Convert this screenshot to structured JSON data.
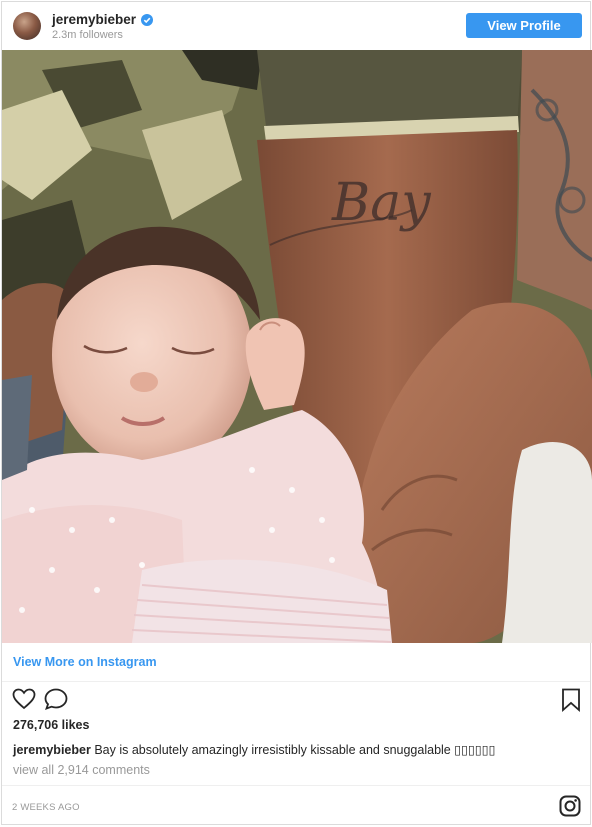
{
  "header": {
    "username": "jeremybieber",
    "followers": "2.3m followers",
    "view_profile_label": "View Profile",
    "avatar_icon": "user-avatar",
    "verified_icon": "verified-badge-icon"
  },
  "photo": {
    "tattoo_text": "Bay"
  },
  "links": {
    "view_more": "View More on Instagram"
  },
  "actions": {
    "like_icon": "heart-icon",
    "comment_icon": "comment-icon",
    "save_icon": "bookmark-icon"
  },
  "post": {
    "likes": "276,706 likes",
    "caption_user": "jeremybieber",
    "caption_text": "Bay is absolutely amazingly irresistibly kissable and snuggalable ▯▯▯▯▯▯",
    "view_comments": "view all 2,914 comments",
    "timestamp": "2 WEEKS AGO",
    "instagram_icon": "instagram-logo-icon"
  },
  "colors": {
    "accent": "#3897f0",
    "text": "#262626",
    "muted": "#999999",
    "border": "#dbdbdb"
  }
}
